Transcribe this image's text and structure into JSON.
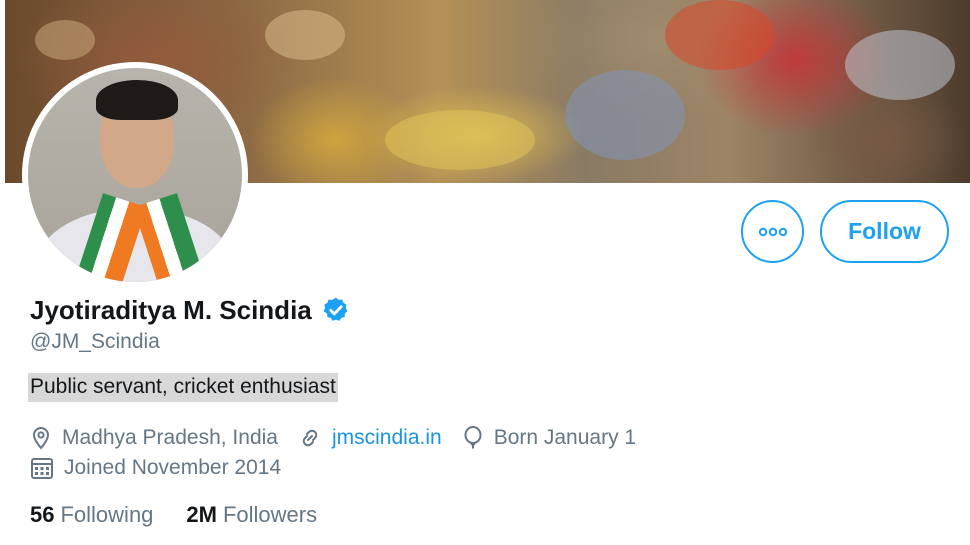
{
  "profile": {
    "display_name": "Jyotiraditya M. Scindia",
    "handle": "@JM_Scindia",
    "bio": "Public servant, cricket enthusiast",
    "verified": true,
    "location": "Madhya Pradesh, India",
    "website": "jmscindia.in",
    "birthday": "Born January 1",
    "joined": "Joined November 2014"
  },
  "actions": {
    "follow_label": "Follow",
    "more_icon": "more-horizontal-icon"
  },
  "stats": {
    "following_count": "56",
    "following_label": "Following",
    "followers_count": "2M",
    "followers_label": "Followers"
  },
  "icons": {
    "location": "location-pin-icon",
    "website": "link-icon",
    "birthday": "balloon-icon",
    "joined": "calendar-icon",
    "verified": "verified-badge-icon"
  },
  "colors": {
    "accent": "#1da1f2",
    "link": "#1b95e0",
    "secondary_text": "#657786",
    "primary_text": "#14171a"
  }
}
